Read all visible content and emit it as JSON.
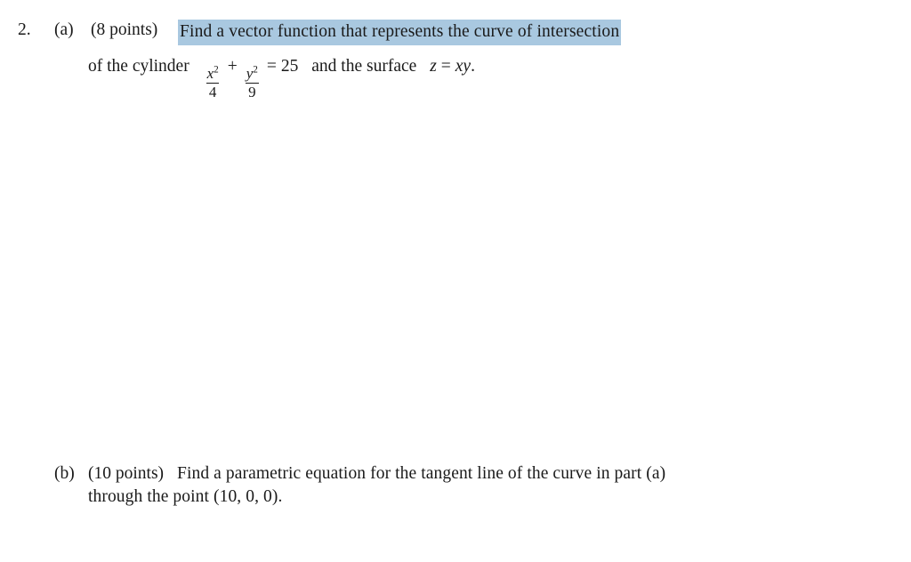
{
  "document": {
    "background_color": "#ffffff",
    "text_color": "#1a1a1a",
    "highlight_color": "#a9c8e0"
  },
  "problem": {
    "number": "2.",
    "parts": {
      "a": {
        "label": "(a)",
        "points": "(8 points)",
        "highlighted_text": "Find a vector function that represents the curve of intersection",
        "line2": {
          "lead_text": "of the cylinder",
          "fraction1": {
            "numerator_base": "x",
            "numerator_exponent": "2",
            "denominator": "4"
          },
          "operator": "+",
          "fraction2": {
            "numerator_base": "y",
            "numerator_exponent": "2",
            "denominator": "9"
          },
          "equals": "=",
          "value": "25",
          "mid_text": "and the surface",
          "surface_var": "z",
          "surface_equals": "=",
          "surface_expr": "xy",
          "period": "."
        }
      },
      "b": {
        "label": "(b)",
        "points": "(10 points)",
        "line1": "Find a parametric equation for the tangent line of the curve in part (a)",
        "line2": "through the point (10, 0, 0)."
      }
    }
  }
}
